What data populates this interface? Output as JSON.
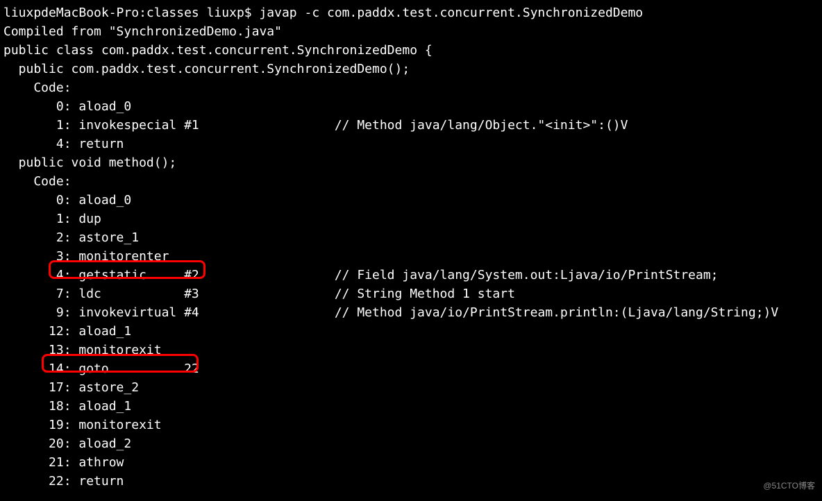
{
  "prompt": "liuxpdeMacBook-Pro:classes liuxp$ javap -c com.paddx.test.concurrent.SynchronizedDemo",
  "compiled_from": "Compiled from \"SynchronizedDemo.java\"",
  "class_decl": "public class com.paddx.test.concurrent.SynchronizedDemo {",
  "constructor_decl": "  public com.paddx.test.concurrent.SynchronizedDemo();",
  "code_label1": "    Code:",
  "ctor_lines": [
    "       0: aload_0",
    "       1: invokespecial #1                  // Method java/lang/Object.\"<init>\":()V",
    "       4: return"
  ],
  "blank": "",
  "method_decl": "  public void method();",
  "code_label2": "    Code:",
  "method_lines": [
    "       0: aload_0",
    "       1: dup",
    "       2: astore_1",
    "       3: monitorenter",
    "       4: getstatic     #2                  // Field java/lang/System.out:Ljava/io/PrintStream;",
    "       7: ldc           #3                  // String Method 1 start",
    "       9: invokevirtual #4                  // Method java/io/PrintStream.println:(Ljava/lang/String;)V",
    "      12: aload_1",
    "      13: monitorexit",
    "      14: goto          22",
    "      17: astore_2",
    "      18: aload_1",
    "      19: monitorexit",
    "      20: aload_2",
    "      21: athrow",
    "      22: return"
  ],
  "watermark": "@51CTO博客"
}
